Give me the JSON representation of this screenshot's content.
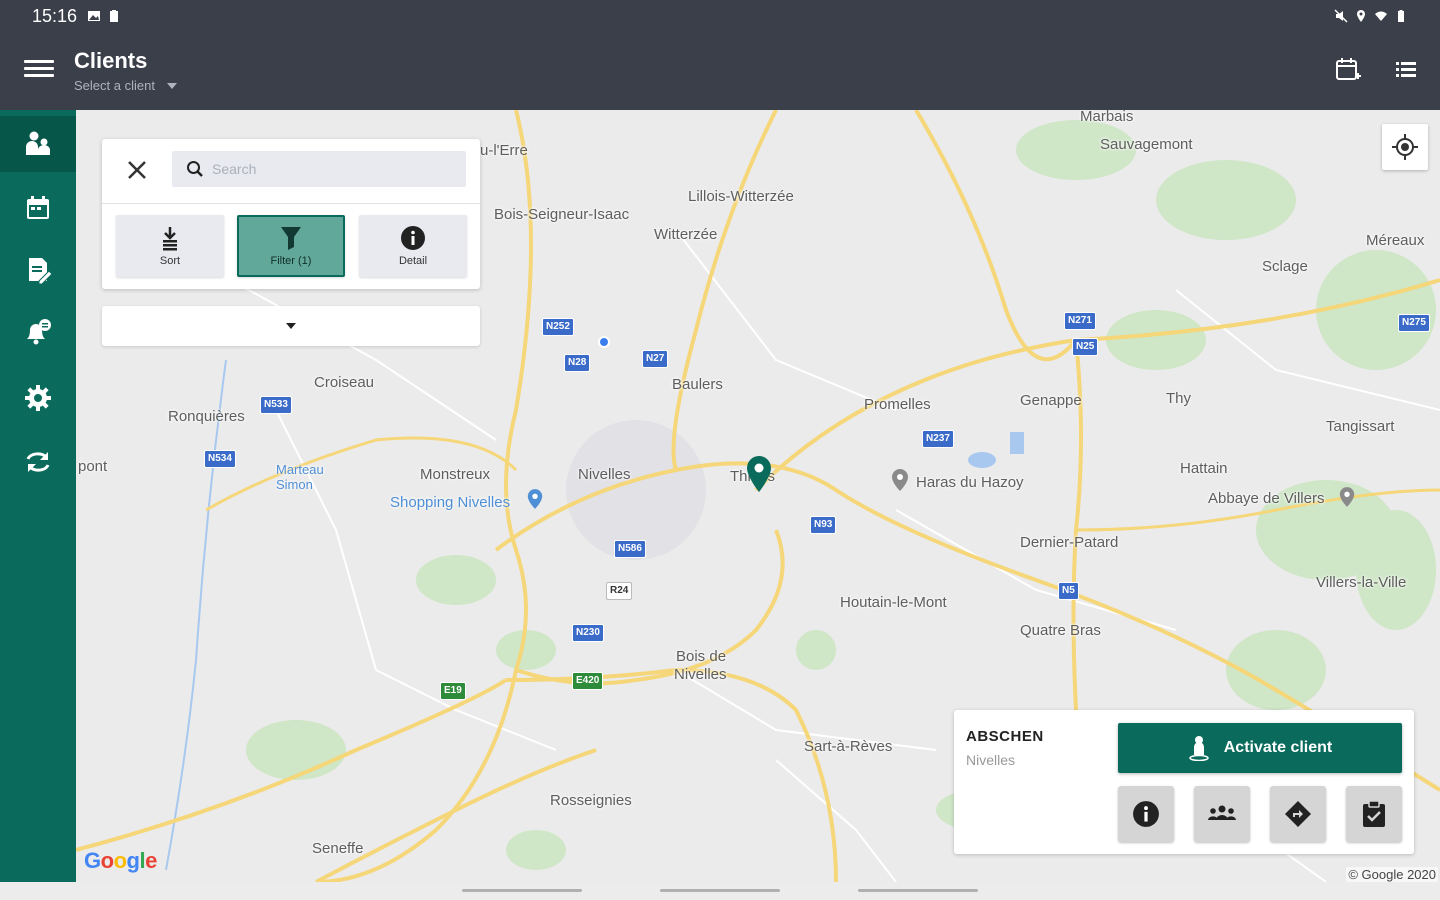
{
  "status_bar": {
    "time": "15:16"
  },
  "app_bar": {
    "title": "Clients",
    "subtitle": "Select a client"
  },
  "sidebar": {
    "items": [
      {
        "icon": "clients-icon",
        "active": true
      },
      {
        "icon": "calendar-icon",
        "active": false
      },
      {
        "icon": "edit-document-icon",
        "active": false
      },
      {
        "icon": "notifications-icon",
        "active": false
      },
      {
        "icon": "settings-icon",
        "active": false
      },
      {
        "icon": "sync-icon",
        "active": false
      }
    ]
  },
  "search_panel": {
    "search_placeholder": "Search",
    "buttons": {
      "sort": "Sort",
      "filter": "Filter (1)",
      "detail": "Detail"
    },
    "dropdown_value": ""
  },
  "map": {
    "places": {
      "p1": "Marbais",
      "p2": "Sauvagemont",
      "p3": "Méreaux",
      "p4": "Sclage",
      "p5": "Lillois-Witterzée",
      "p6": "Bois-Seigneur-Isaac",
      "p7": "Witterzée",
      "p8": "Croiseau",
      "p9": "Ronquières",
      "p10": "Baulers",
      "p11": "Promelles",
      "p12": "Genappe",
      "p13": "Thy",
      "p14": "Tangissart",
      "p15": "Monstreux",
      "p16": "Shopping Nivelles",
      "p17": "Nivelles",
      "p18": "Thines",
      "p19": "Haras du Hazoy",
      "p20": "Hattain",
      "p21": "Abbaye de Villers",
      "p22": "Dernier-Patard",
      "p23": "Villers-la-Ville",
      "p24": "Houtain-le-Mont",
      "p25": "Quatre Bras",
      "p26": "Bois de",
      "p27": "Nivelles",
      "p28": "Sart-à-Rèves",
      "p29": "Rosseignies",
      "p30": "Seneffe",
      "p31": "Marteau Simon",
      "p32": "pont",
      "p33": "u-l'Erre"
    },
    "roads": {
      "r1": "N252",
      "r2": "N28",
      "r3": "N27",
      "r4": "N533",
      "r5": "N534",
      "r6": "N237",
      "r7": "N93",
      "r8": "N586",
      "r9": "R24",
      "r10": "N230",
      "r11": "E420",
      "r12": "E19",
      "r13": "N5",
      "r14": "N271",
      "r15": "N25",
      "r16": "N275"
    },
    "copyright": "© Google 2020"
  },
  "client_card": {
    "name": "ABSCHEN",
    "city": "Nivelles",
    "activate_label": "Activate client"
  }
}
